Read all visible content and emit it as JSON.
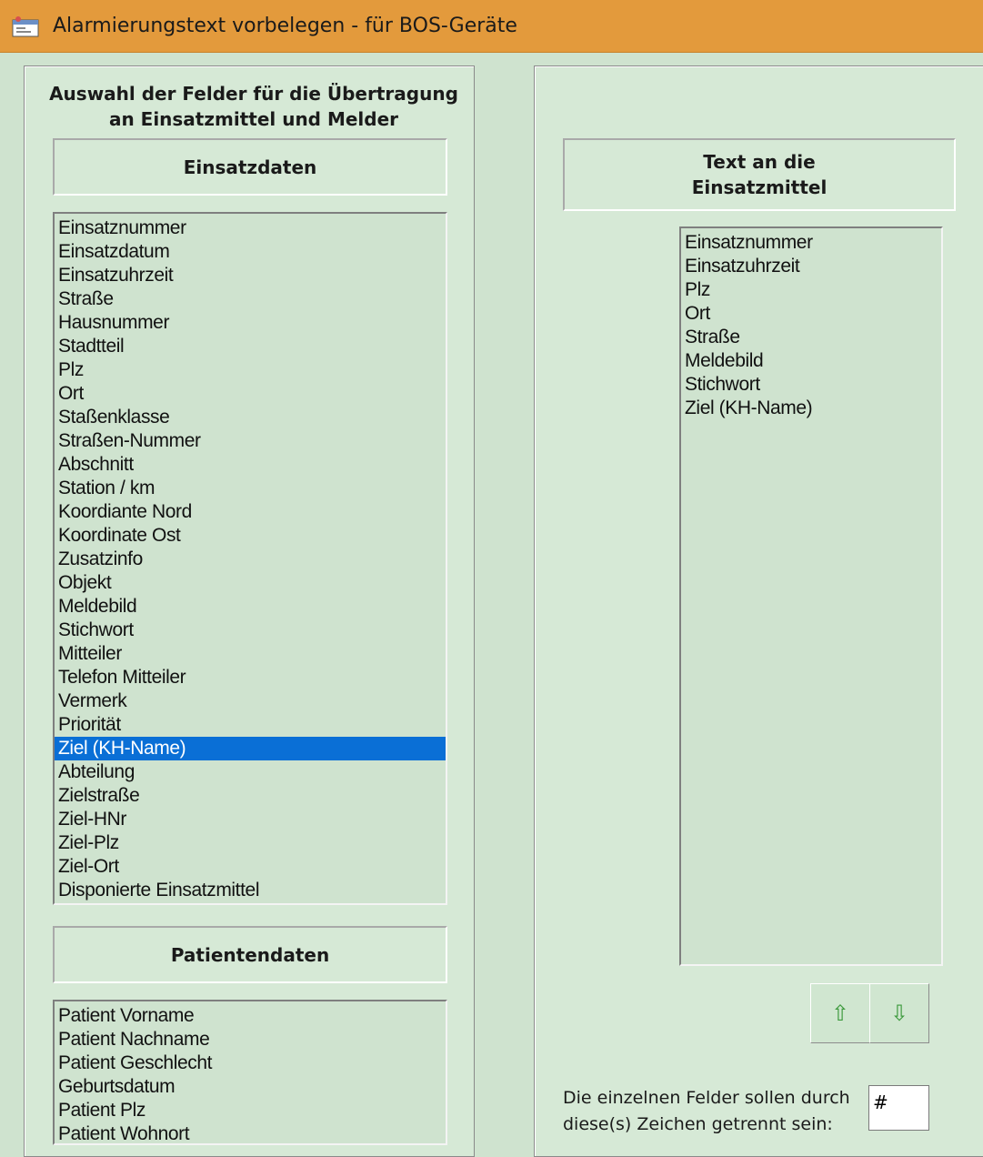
{
  "window": {
    "title": "Alarmierungstext vorbelegen - für BOS-Geräte",
    "icon": "app-window-icon"
  },
  "left_panel": {
    "heading_line1": "Auswahl der Felder für die Übertragung",
    "heading_line2": "an Einsatzmittel und Melder",
    "einsatzdaten": {
      "label": "Einsatzdaten",
      "items": [
        "Einsatznummer",
        "Einsatzdatum",
        "Einsatzuhrzeit",
        "Straße",
        "Hausnummer",
        "Stadtteil",
        "Plz",
        "Ort",
        "Staßenklasse",
        "Straßen-Nummer",
        "Abschnitt",
        "Station / km",
        "Koordiante Nord",
        "Koordinate Ost",
        "Zusatzinfo",
        "Objekt",
        "Meldebild",
        "Stichwort",
        "Mitteiler",
        "Telefon Mitteiler",
        "Vermerk",
        "Priorität",
        "Ziel (KH-Name)",
        "Abteilung",
        "Zielstraße",
        "Ziel-HNr",
        "Ziel-Plz",
        "Ziel-Ort",
        "Disponierte Einsatzmittel"
      ],
      "selected": "Ziel (KH-Name)"
    },
    "patientendaten": {
      "label": "Patientendaten",
      "items": [
        "Patient Vorname",
        "Patient Nachname",
        "Patient Geschlecht",
        "Geburtsdatum",
        "Patient Plz",
        "Patient Wohnort"
      ]
    }
  },
  "buttons": {
    "add_icon": "arrow-right-circle-icon",
    "add_glyph": "➜",
    "remove_icon": "arrow-left-circle-icon",
    "remove_glyph": "⬅",
    "move_up_icon": "arrow-up-icon",
    "move_up_glyph": "⇧",
    "move_down_icon": "arrow-down-icon",
    "move_down_glyph": "⇩"
  },
  "right_panel": {
    "target_label_line1": "Text an die",
    "target_label_line2": "Einsatzmittel",
    "target_items": [
      "Einsatznummer",
      "Einsatzuhrzeit",
      "Plz",
      "Ort",
      "Straße",
      "Meldebild",
      "Stichwort",
      "Ziel (KH-Name)"
    ],
    "separator_label_line1": "Die einzelnen Felder sollen durch",
    "separator_label_line2": "diese(s) Zeichen getrennt sein:",
    "separator_value": "#"
  },
  "colors": {
    "titlebar": "#e39a3c",
    "background": "#cfe3cf",
    "selection": "#0a6fd6",
    "icon_green": "#1d8f1d"
  }
}
